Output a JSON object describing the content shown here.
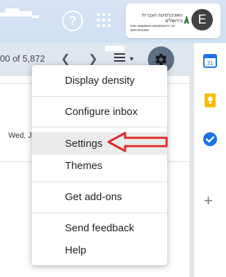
{
  "header": {
    "help_icon": "help-icon",
    "apps_icon": "apps-grid-icon",
    "brand": {
      "line1": "האוניברסיטה העברית בירושלים",
      "line2": "THE HEBREW UNIVERSITY OF JERUSALEM"
    },
    "avatar_letter": "E"
  },
  "toolbar": {
    "count_text": "00 of 5,872",
    "prev_icon": "chevron-left-icon",
    "next_icon": "chevron-right-icon",
    "density_icon": "density-icon",
    "caret_icon": "caret-down-icon",
    "settings_icon": "gear-icon"
  },
  "message_list": {
    "date_fragment": "Wed, J"
  },
  "menu": {
    "items": [
      {
        "label": "Display density"
      },
      {
        "label": "Configure inbox"
      },
      {
        "label": "Settings"
      },
      {
        "label": "Themes"
      },
      {
        "label": "Get add-ons"
      },
      {
        "label": "Send feedback"
      },
      {
        "label": "Help"
      }
    ]
  },
  "sidebar": {
    "icons": [
      "calendar-icon",
      "keep-icon",
      "tasks-icon",
      "plus-icon"
    ],
    "calendar_day": "31"
  },
  "colors": {
    "accent_red": "#e02b2b",
    "gear_bg": "#5e6f84",
    "avatar_bg": "#424242"
  }
}
